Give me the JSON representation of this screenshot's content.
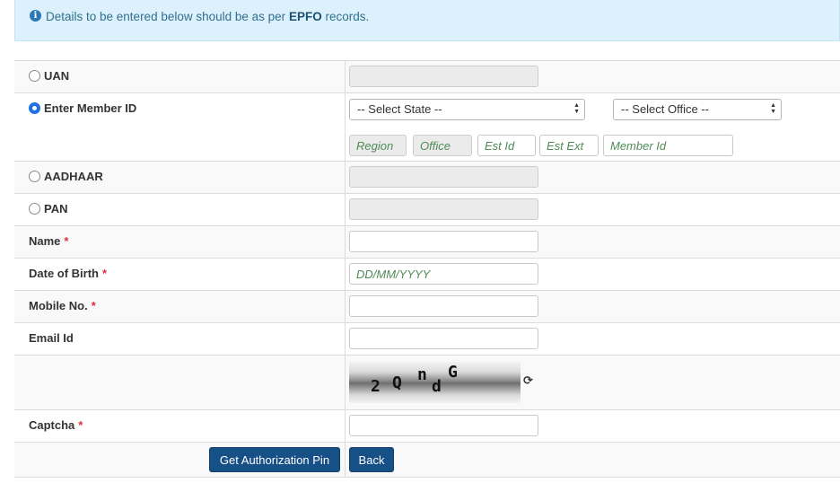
{
  "alert": {
    "text_before": "Details to be entered below should be as per ",
    "text_bold": "EPFO",
    "text_after": " records."
  },
  "fields": {
    "uan_label": "UAN",
    "member_id_label": "Enter Member ID",
    "state_select": "-- Select State --",
    "office_select": "-- Select Office --",
    "region_placeholder": "Region",
    "office_placeholder": "Office",
    "est_id_placeholder": "Est Id",
    "est_ext_placeholder": "Est Ext",
    "member_id_placeholder": "Member Id",
    "aadhaar_label": "AADHAAR",
    "pan_label": "PAN",
    "name_label": "Name",
    "dob_label": "Date of Birth",
    "dob_placeholder": "DD/MM/YYYY",
    "mobile_label": "Mobile No.",
    "email_label": "Email Id",
    "captcha_label": "Captcha",
    "required_mark": "*"
  },
  "selected_option": "member_id",
  "captcha_chars": [
    "2",
    "Q",
    "n",
    "d",
    "G"
  ],
  "buttons": {
    "auth_pin": "Get Authorization Pin",
    "back": "Back"
  },
  "icons": {
    "info": "info-circle-icon",
    "refresh": "refresh-icon"
  },
  "colors": {
    "primary": "#174f87",
    "radio_selected": "#1f6fe5",
    "required": "#d9303b",
    "alert_bg": "#dcf1fb"
  }
}
